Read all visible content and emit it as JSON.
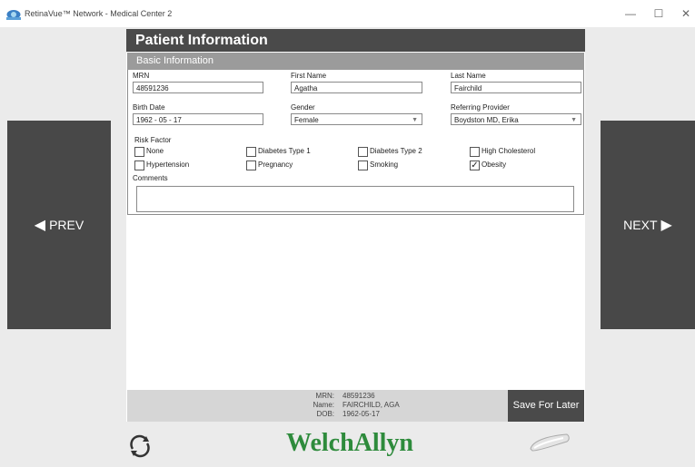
{
  "window": {
    "title": "RetinaVue™ Network - Medical Center 2",
    "min_icon": "—",
    "max_icon": "☐",
    "close_icon": "✕"
  },
  "nav": {
    "prev_label": "PREV",
    "next_label": "NEXT",
    "prev_icon": "◀",
    "next_icon": "▶"
  },
  "page": {
    "title": "Patient Information",
    "section_title": "Basic Information"
  },
  "fields": {
    "mrn": {
      "label": "MRN",
      "value": "48591236"
    },
    "first_name": {
      "label": "First Name",
      "value": "Agatha"
    },
    "last_name": {
      "label": "Last Name",
      "value": "Fairchild"
    },
    "birth_date": {
      "label": "Birth Date",
      "value": "1962  - 05   - 17"
    },
    "gender": {
      "label": "Gender",
      "value": "Female"
    },
    "referring_provider": {
      "label": "Referring Provider",
      "value": "Boydston MD, Erika"
    }
  },
  "risk_factor": {
    "label": "Risk Factor",
    "items": [
      {
        "label": "None",
        "checked": false
      },
      {
        "label": "Diabetes Type 1",
        "checked": false
      },
      {
        "label": "Diabetes Type 2",
        "checked": false
      },
      {
        "label": "High Cholesterol",
        "checked": false
      },
      {
        "label": "Hypertension",
        "checked": false
      },
      {
        "label": "Pregnancy",
        "checked": false
      },
      {
        "label": "Smoking",
        "checked": false
      },
      {
        "label": "Obesity",
        "checked": true
      }
    ]
  },
  "comments": {
    "label": "Comments",
    "value": ""
  },
  "summary": {
    "mrn_label": "MRN:",
    "mrn_value": "48591236",
    "name_label": "Name:",
    "name_value": "FAIRCHILD, AGA",
    "dob_label": "DOB:",
    "dob_value": "1962-05-17"
  },
  "buttons": {
    "save_for_later": "Save For Later"
  },
  "brand": {
    "logo_text": "WelchAllyn",
    "logo_color": "#2e8b3c"
  },
  "icons": {
    "refresh": "refresh-icon",
    "camera": "camera-icon",
    "dropdown_arrow": "▼",
    "check_mark": "✓"
  }
}
